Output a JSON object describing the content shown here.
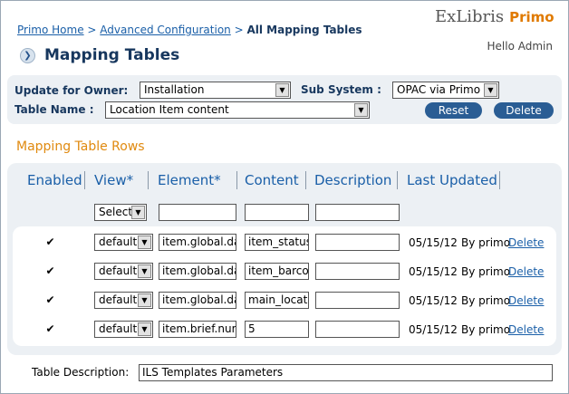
{
  "header": {
    "crumb_home": "Primo Home",
    "crumb_sep": ">",
    "crumb_advanced": "Advanced Configuration",
    "crumb_current": "All Mapping Tables",
    "logo_ex": "ExLibris",
    "logo_primo": "Primo",
    "greeting": "Hello Admin",
    "title": "Mapping Tables"
  },
  "owner": {
    "owner_label": "Update for Owner:",
    "owner_value": "Installation",
    "subsystem_label": "Sub System :",
    "subsystem_value": "OPAC via Primo",
    "table_label": "Table Name :",
    "table_value": "Location Item content",
    "reset_label": "Reset",
    "delete_label": "Delete"
  },
  "section_title": "Mapping Table Rows",
  "table": {
    "columns": [
      "Enabled",
      "View*",
      "Element*",
      "Content",
      "Description",
      "Last Updated"
    ],
    "filter_view": "Select",
    "rows": [
      {
        "enabled": true,
        "view": "default",
        "element": "item.global.da",
        "content": "item_status",
        "description": "",
        "date": "05/15/12",
        "by": "By primo",
        "delete": "Delete"
      },
      {
        "enabled": true,
        "view": "default",
        "element": "item.global.da",
        "content": "item_barco",
        "description": "",
        "date": "05/15/12",
        "by": "By primo",
        "delete": "Delete"
      },
      {
        "enabled": true,
        "view": "default",
        "element": "item.global.da",
        "content": "main_locati",
        "description": "",
        "date": "05/15/12",
        "by": "By primo",
        "delete": "Delete"
      },
      {
        "enabled": true,
        "view": "default",
        "element": "item.brief.num",
        "content": "5",
        "description": "",
        "date": "05/15/12",
        "by": "By primo",
        "delete": "Delete"
      }
    ]
  },
  "footer": {
    "desc_label": "Table Description:",
    "desc_value": "ILS Templates Parameters"
  }
}
